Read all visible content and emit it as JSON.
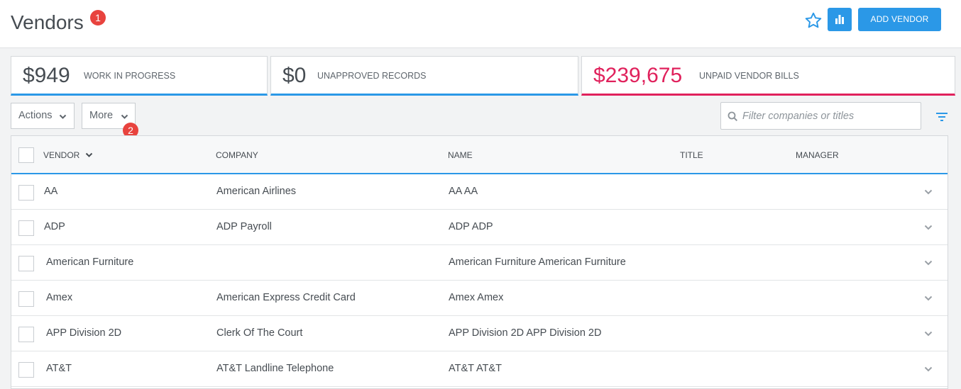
{
  "header": {
    "title": "Vendors",
    "badge": "1",
    "add_label": "ADD VENDOR"
  },
  "stats": [
    {
      "amount": "$949",
      "label": "WORK IN PROGRESS"
    },
    {
      "amount": "$0",
      "label": "UNAPPROVED RECORDS"
    },
    {
      "amount": "$239,675",
      "label": "UNPAID VENDOR BILLS"
    }
  ],
  "toolbar": {
    "actions_label": "Actions",
    "more_label": "More",
    "more_badge": "2",
    "search_placeholder": "Filter companies or titles"
  },
  "table": {
    "columns": [
      "VENDOR",
      "COMPANY",
      "NAME",
      "TITLE",
      "MANAGER"
    ],
    "rows": [
      {
        "vendor": "AA",
        "company": "American Airlines",
        "name": "AA AA",
        "title": "",
        "manager": ""
      },
      {
        "vendor": "ADP",
        "company": "ADP Payroll",
        "name": "ADP ADP",
        "title": "",
        "manager": ""
      },
      {
        "vendor": "American Furniture",
        "company": "",
        "name": "American Furniture American Furniture",
        "title": "",
        "manager": ""
      },
      {
        "vendor": "Amex",
        "company": "American Express Credit Card",
        "name": "Amex Amex",
        "title": "",
        "manager": ""
      },
      {
        "vendor": "APP Division 2D",
        "company": "Clerk Of The Court",
        "name": "APP Division 2D APP Division 2D",
        "title": "",
        "manager": ""
      },
      {
        "vendor": "AT&T",
        "company": "AT&T Landline Telephone",
        "name": "AT&T AT&T",
        "title": "",
        "manager": ""
      }
    ]
  },
  "colors": {
    "accent": "#2b98e7",
    "alert": "#e0215c",
    "badge": "#e8433e"
  },
  "icons": {
    "favorite": "star-icon",
    "reports": "bar-chart-icon",
    "search": "search-icon",
    "filter": "filter-icon",
    "dropdown": "chevron-down-icon"
  }
}
